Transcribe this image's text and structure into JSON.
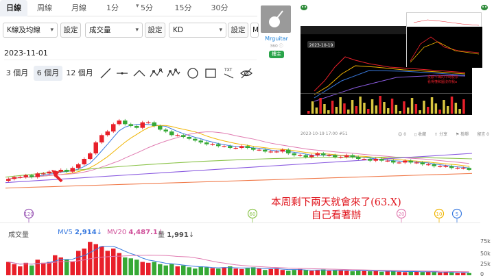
{
  "tabs": [
    {
      "label": "日線",
      "active": true
    },
    {
      "label": "周線"
    },
    {
      "label": "月線"
    },
    {
      "label": "1分"
    },
    {
      "label": "5分"
    },
    {
      "label": "15分"
    },
    {
      "label": "30分"
    }
  ],
  "controls": {
    "indicator_main": "K線及均線",
    "indicator_volume": "成交量",
    "indicator_kd": "KD",
    "indicator_extra": "M",
    "settings_label": "設定"
  },
  "date_value": "2023-11-01",
  "ranges": [
    {
      "label": "3 個月"
    },
    {
      "label": "6 個月",
      "active": true
    },
    {
      "label": "12 個月"
    }
  ],
  "draw_tools": [
    "line-tool-icon",
    "horizontal-line-tool-icon",
    "angle-tool-icon",
    "wave-tool-icon",
    "zigzag-tool-icon",
    "circle-tool-icon",
    "rectangle-tool-icon",
    "text-tool-icon",
    "hide-eye-icon"
  ],
  "profile": {
    "name": "Mrguitar",
    "subtitle": "360 ⓘ",
    "badge": "樓主"
  },
  "embed": {
    "date_label": "2023-10-19",
    "note_line1": "投顧卡職的中時股票",
    "note_line2": "看得懂和圖沒你我a"
  },
  "post_meta": {
    "timestamp": "2023-10-19 17:00 #51",
    "reply_count": "0",
    "bookmark": "收藏",
    "share": "分享",
    "report": "檢舉",
    "comments": "留言 0"
  },
  "annotation": {
    "line1": "本周剩下兩天就會來了(63.X)",
    "line2": "自己看著辦"
  },
  "period_markers": [
    {
      "label": "120",
      "color": "#9b59b6"
    },
    {
      "label": "60",
      "color": "#8bc34a"
    },
    {
      "label": "20",
      "color": "#e07ab0"
    },
    {
      "label": "10",
      "color": "#f0b400"
    },
    {
      "label": "5",
      "color": "#3a7be0"
    }
  ],
  "volume_legend": {
    "title": "成交量",
    "mv5_label": "MV5",
    "mv5_value": "2,914",
    "mv20_label": "MV20",
    "mv20_value": "4,487.1",
    "vol_label": "量",
    "vol_value": "1,991",
    "arrow": "↓"
  },
  "volume_axis": [
    "75k",
    "50k",
    "25k",
    "0"
  ],
  "colors": {
    "up": "#e8202a",
    "down": "#36a936",
    "ma5": "#3a7be0",
    "ma10": "#f0b400",
    "ma20": "#e07ab0",
    "ma60": "#8bc34a",
    "ma120": "#8a5be0",
    "ma240": "#f07a4a"
  },
  "chart_data": {
    "type": "candlestick",
    "ylim": [
      0,
      100
    ],
    "candles_close": [
      32,
      33,
      33,
      34,
      33,
      35,
      35,
      36,
      36,
      37,
      36,
      38,
      40,
      43,
      46,
      52,
      56,
      58,
      62,
      64,
      62,
      61,
      60,
      63,
      63,
      61,
      59,
      58,
      56,
      56,
      55,
      54,
      53,
      52,
      51,
      51,
      50,
      50,
      49,
      49,
      50,
      49,
      48,
      48,
      47,
      47,
      47,
      48,
      46,
      45,
      45,
      44,
      45,
      46,
      45,
      45,
      44,
      44,
      45,
      44,
      43,
      43,
      42,
      43,
      42,
      42,
      41,
      41,
      42,
      41,
      41,
      40,
      40,
      39,
      39,
      39,
      38,
      38,
      38,
      37
    ],
    "volume": [
      30,
      25,
      20,
      28,
      22,
      35,
      28,
      30,
      45,
      40,
      35,
      30,
      55,
      60,
      75,
      70,
      65,
      55,
      60,
      50,
      40,
      38,
      35,
      30,
      28,
      30,
      25,
      22,
      25,
      20,
      22,
      18,
      15,
      20,
      18,
      16,
      15,
      18,
      20,
      15,
      14,
      16,
      18,
      15,
      12,
      14,
      16,
      12,
      10,
      12,
      14,
      12,
      10,
      11,
      13,
      10,
      12,
      11,
      10,
      9,
      11,
      10,
      9,
      10,
      8,
      9,
      10,
      8,
      7,
      9,
      8,
      7,
      8,
      7,
      6,
      7,
      6,
      5,
      6,
      5
    ]
  }
}
